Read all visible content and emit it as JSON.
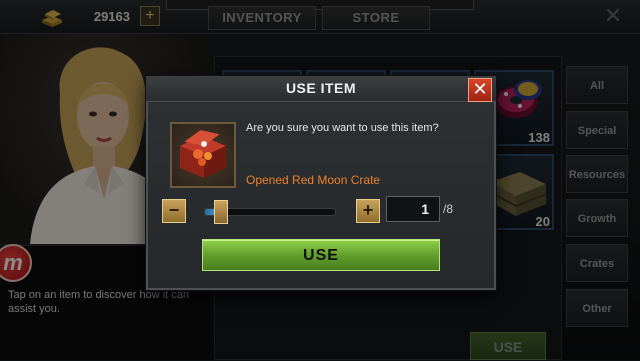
{
  "header": {
    "gold_amount": "29163",
    "add_gold_label": "+",
    "tabs": [
      {
        "label": "INVENTORY"
      },
      {
        "label": "STORE"
      }
    ],
    "close_label": "✕"
  },
  "side_tabs": [
    {
      "label": "All"
    },
    {
      "label": "Special"
    },
    {
      "label": "Resources"
    },
    {
      "label": "Growth"
    },
    {
      "label": "Crates"
    },
    {
      "label": "Other"
    }
  ],
  "inventory": {
    "slot_counts": [
      "138",
      "20"
    ],
    "bg_use_label": "USE"
  },
  "advisor": {
    "logo_letter": "m",
    "help_text": "Tap on an item to discover how it can assist you."
  },
  "dialog": {
    "title": "USE ITEM",
    "close_label": "✕",
    "confirm_text": "Are you sure you want to use this item?",
    "item_name": "Opened Red Moon Crate",
    "item_name_color": "#e9802c",
    "minus_label": "−",
    "plus_label": "+",
    "quantity": "1",
    "max_quantity": "/8",
    "slider_fraction": 0.125,
    "use_label": "USE"
  }
}
